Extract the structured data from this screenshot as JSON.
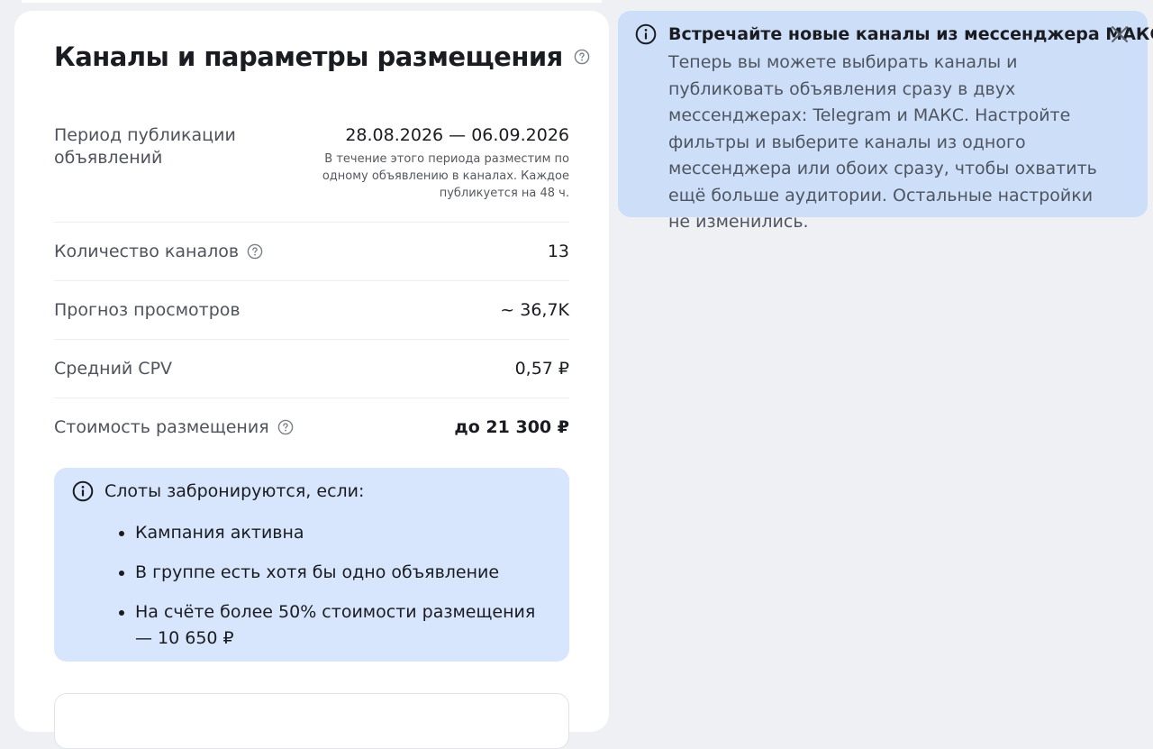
{
  "placement": {
    "title": "Каналы и параметры размещения",
    "period": {
      "label": "Период публикации объявлений",
      "dates": "28.08.2026 — 06.09.2026",
      "note": "В течение этого периода разместим по одному объявлению в каналах. Каждое публикуется на 48 ч."
    },
    "channels": {
      "label": "Количество каналов",
      "value": "13"
    },
    "views": {
      "label": "Прогноз просмотров",
      "value": "~ 36,7K"
    },
    "cpv": {
      "label": "Средний CPV",
      "value": "0,57 ₽"
    },
    "cost": {
      "label": "Стоимость размещения",
      "value": "до 21 300 ₽"
    },
    "slots": {
      "title": "Слоты забронируются, если:",
      "items": [
        "Кампания активна",
        "В группе есть хотя бы одно объявление",
        "На счёте более 50% стоимости размещения — 10 650 ₽"
      ]
    }
  },
  "notice": {
    "title": "Встречайте новые каналы из мессенджера МАКС",
    "text": "Теперь вы можете выбирать каналы и публиковать объявления сразу в двух мессенджерах: Telegram и МАКС. Настройте фильтры и выберите каналы из одного мессенджера или обоих сразу, чтобы охватить ещё больше аудитории. Остальные настройки не изменились."
  },
  "icons": {
    "help": "question-circle-icon",
    "info": "info-circle-icon",
    "close": "close-icon"
  },
  "colors": {
    "notice_bg": "#cddff8",
    "slots_bg": "#d7e6fc",
    "card_bg": "#ffffff",
    "page_bg": "#eef0f4"
  }
}
